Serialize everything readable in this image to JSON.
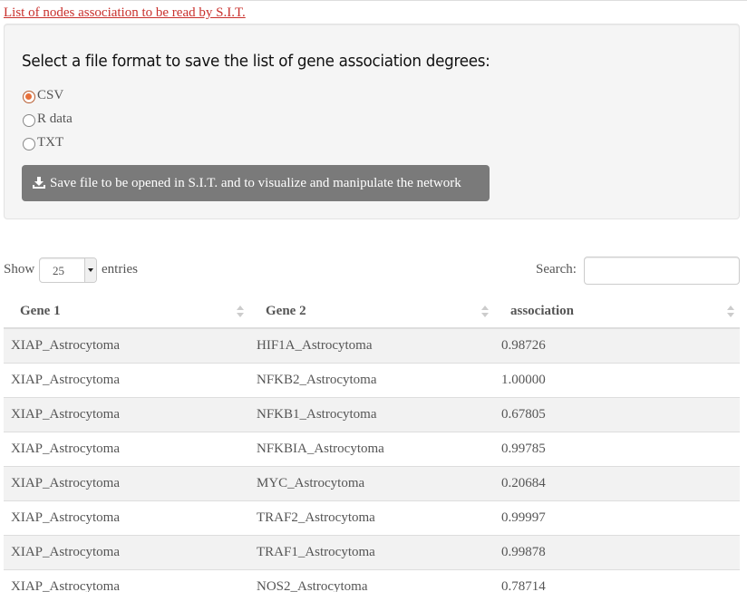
{
  "header": {
    "link_text": "List of nodes association to be read by S.I.T."
  },
  "format_panel": {
    "heading": "Select a file format to save the list of gene association degrees:",
    "options": [
      {
        "label": "CSV",
        "checked": true
      },
      {
        "label": "R data",
        "checked": false
      },
      {
        "label": "TXT",
        "checked": false
      }
    ],
    "save_button_label": "Save file to be opened in S.I.T. and to visualize and manipulate the network",
    "save_button_icon": "download-icon"
  },
  "table_controls": {
    "show_label": "Show",
    "entries_value": "25",
    "entries_label": "entries",
    "search_label": "Search:",
    "search_value": ""
  },
  "table": {
    "columns": [
      "Gene 1",
      "Gene 2",
      "association"
    ],
    "rows": [
      [
        "XIAP_Astrocytoma",
        "HIF1A_Astrocytoma",
        "0.98726"
      ],
      [
        "XIAP_Astrocytoma",
        "NFKB2_Astrocytoma",
        "1.00000"
      ],
      [
        "XIAP_Astrocytoma",
        "NFKB1_Astrocytoma",
        "0.67805"
      ],
      [
        "XIAP_Astrocytoma",
        "NFKBIA_Astrocytoma",
        "0.99785"
      ],
      [
        "XIAP_Astrocytoma",
        "MYC_Astrocytoma",
        "0.20684"
      ],
      [
        "XIAP_Astrocytoma",
        "TRAF2_Astrocytoma",
        "0.99997"
      ],
      [
        "XIAP_Astrocytoma",
        "TRAF1_Astrocytoma",
        "0.99878"
      ],
      [
        "XIAP_Astrocytoma",
        "NOS2_Astrocytoma",
        "0.78714"
      ]
    ]
  },
  "colors": {
    "link": "#c9302c",
    "button_bg": "#7a7a7a",
    "radio_accent": "#e8703a"
  }
}
